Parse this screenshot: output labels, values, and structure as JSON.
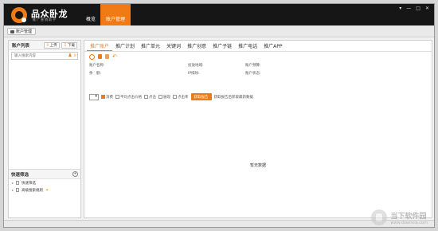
{
  "app": {
    "brand": "品众卧龙",
    "brand_sub": "推广营销助手",
    "nav": [
      "概览",
      "账户管理"
    ],
    "active_nav": "账户管理",
    "window_controls": [
      "▾",
      "—",
      "□",
      "✕"
    ]
  },
  "toolbar": {
    "account_manage": "账户管理"
  },
  "left": {
    "title": "账户列表",
    "upload_label": "上传",
    "download_label": "下载",
    "search_placeholder": "输入搜索内容",
    "quick_title": "快速筛选",
    "quick_items": [
      "快速筛选",
      "高级搜索规则"
    ]
  },
  "right": {
    "tabs": [
      "推广账户",
      "推广计划",
      "推广单元",
      "关键词",
      "推广创意",
      "推广子链",
      "推广电话",
      "推广APP"
    ],
    "active_tab": "推广账户",
    "info": {
      "account_name": "账户名称:",
      "region": "投放地域:",
      "budget": "账户预算:",
      "balance": "余　额:",
      "ip_exclude": "IP排除:",
      "status": "账户状态:"
    },
    "filter": {
      "options": [
        "消费",
        "平均点击价格",
        "点击",
        "展现",
        "点击率"
      ],
      "checked": "消费",
      "report_button": "获取报告",
      "report_hint": "获取报告后获取最新数据"
    },
    "empty_text": "暂无数据"
  },
  "watermark": {
    "main": "当下软件园",
    "sub": "www.downxia.com"
  },
  "colors": {
    "accent": "#f07a16",
    "header_bg": "#161616"
  }
}
